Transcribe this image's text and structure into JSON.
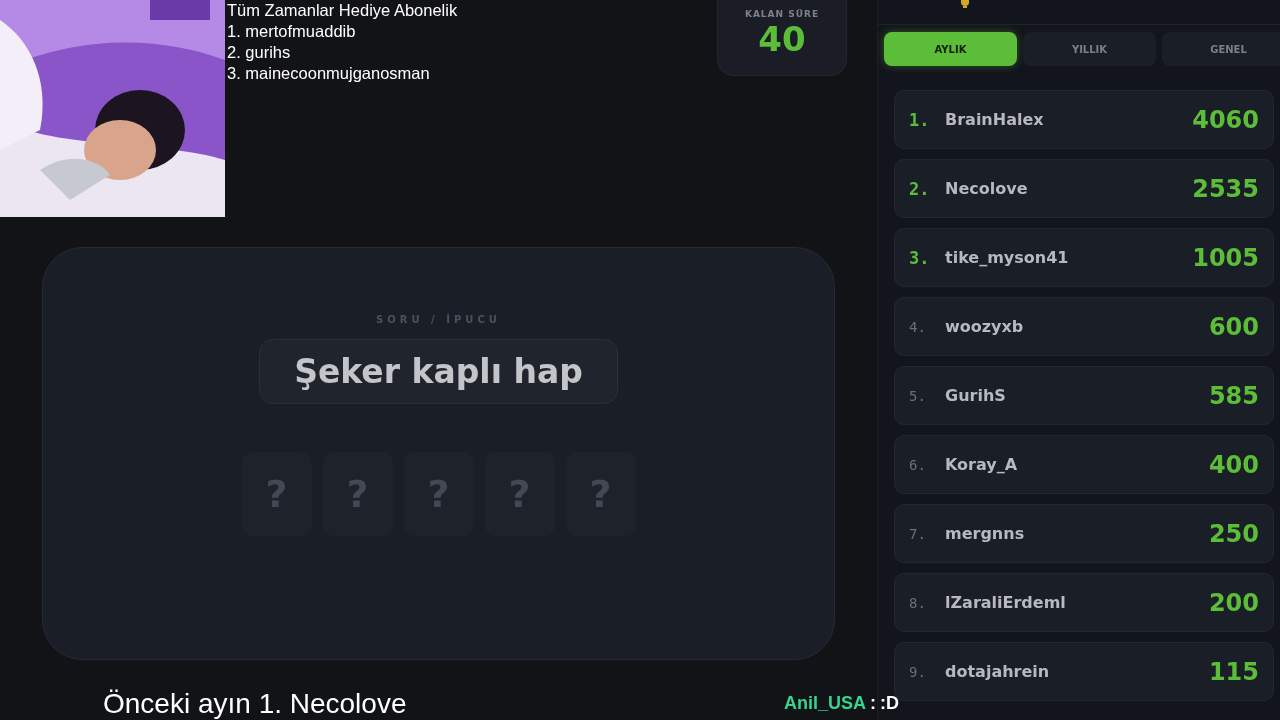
{
  "overlay": {
    "title": "Tüm Zamanlar Hediye  Abonelik",
    "lines": [
      "1. mertofmuaddib",
      "2. gurihs",
      "3. mainecoonmujganosman"
    ]
  },
  "timer": {
    "label": "KALAN SÜRE",
    "value": "40"
  },
  "game": {
    "label": "SORU / İPUCU",
    "clue": "Şeker kaplı hap",
    "tiles": [
      "?",
      "?",
      "?",
      "?",
      "?"
    ]
  },
  "caption": "Önceki ayın 1. Necolove",
  "chat": {
    "user": "Anil_USA",
    "separator": ":",
    "message": ":D"
  },
  "leaderboard": {
    "tabs": [
      {
        "label": "AYLIK",
        "selected": true
      },
      {
        "label": "YILLIK",
        "selected": false
      },
      {
        "label": "GENEL",
        "selected": false
      }
    ],
    "rows": [
      {
        "rank": "1.",
        "name": "BrainHalex",
        "score": "4060",
        "highlighted": true
      },
      {
        "rank": "2.",
        "name": "Necolove",
        "score": "2535",
        "highlighted": true
      },
      {
        "rank": "3.",
        "name": "tike_myson41",
        "score": "1005",
        "highlighted": true
      },
      {
        "rank": "4.",
        "name": "woozyxb",
        "score": "600",
        "highlighted": false
      },
      {
        "rank": "5.",
        "name": "GurihS",
        "score": "585",
        "highlighted": false
      },
      {
        "rank": "6.",
        "name": "Koray_A",
        "score": "400",
        "highlighted": false
      },
      {
        "rank": "7.",
        "name": "mergnns",
        "score": "250",
        "highlighted": false
      },
      {
        "rank": "8.",
        "name": "lZaraliErdeml",
        "score": "200",
        "highlighted": false
      },
      {
        "rank": "9.",
        "name": "dotajahrein",
        "score": "115",
        "highlighted": false
      }
    ]
  }
}
